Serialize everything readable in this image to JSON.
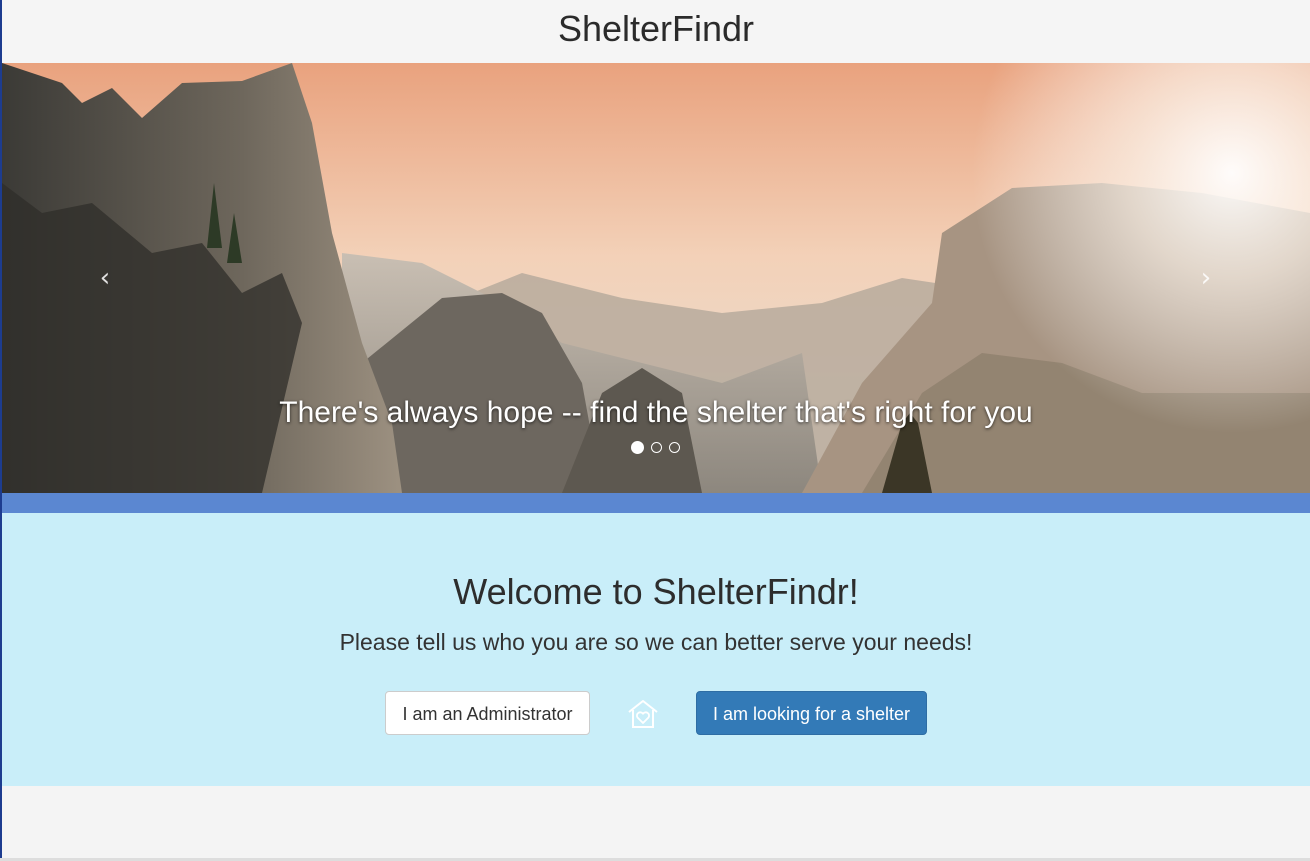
{
  "header": {
    "title": "ShelterFindr"
  },
  "carousel": {
    "caption": "There's always hope -- find the shelter that's right for you",
    "prev_icon": "chevron-left-icon",
    "next_icon": "chevron-right-icon",
    "prev_glyph": "‹",
    "next_glyph": "›",
    "slide_count": 3,
    "active_slide": 1
  },
  "welcome": {
    "heading": "Welcome to ShelterFindr!",
    "subheading": "Please tell us who you are so we can better serve your needs!",
    "admin_button": "I am an Administrator",
    "seeker_button": "I am looking for a shelter",
    "divider_icon": "house-heart-icon"
  },
  "colors": {
    "stripe": "#5b87d1",
    "welcome_background": "#c9eef9",
    "primary_button": "#337ab7"
  }
}
